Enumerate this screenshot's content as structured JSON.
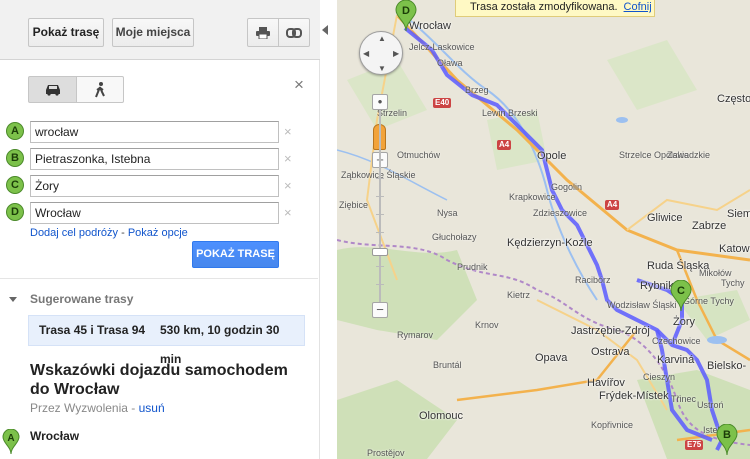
{
  "toolbar": {
    "show_route_label": "Pokaż trasę",
    "my_places_label": "Moje miejsca",
    "print_icon": "printer-icon",
    "link_icon": "link-icon"
  },
  "mode": {
    "car_icon": "car-icon",
    "walk_icon": "walking-icon"
  },
  "waypoints": [
    {
      "letter": "A",
      "value": "wrocław"
    },
    {
      "letter": "B",
      "value": "Pietraszonka, Istebna"
    },
    {
      "letter": "C",
      "value": "Żory"
    },
    {
      "letter": "D",
      "value": "Wrocław"
    }
  ],
  "links": {
    "add_destination": "Dodaj cel podróży",
    "separator": " - ",
    "show_options": "Pokaż opcje"
  },
  "go_button_label": "POKAŻ TRASĘ",
  "suggested": {
    "title": "Sugerowane trasy",
    "route_name": "Trasa 45 i Trasa 94",
    "route_info": "530 km, 10 godzin 30 min"
  },
  "directions": {
    "heading": "Wskazówki dojazdu samochodem do Wrocław",
    "via_prefix": "Przez Wyzwolenia",
    "via_separator": " - ",
    "remove_link": "usuń",
    "start_label": "Wrocław",
    "start_letter": "A"
  },
  "map": {
    "notice_text": "Trasa została zmodyfikowana.",
    "undo_link": "Cofnij",
    "route_color": "#5a5aff",
    "marker_color": "#7cc14a",
    "cities": [
      {
        "name": "Wrocław",
        "cls": "city"
      },
      {
        "name": "Opole",
        "cls": "city"
      },
      {
        "name": "Gliwice",
        "cls": "city"
      },
      {
        "name": "Zabrze",
        "cls": "city"
      },
      {
        "name": "Katowic",
        "cls": "city"
      },
      {
        "name": "Ruda Śląska",
        "cls": "city"
      },
      {
        "name": "Rybnik",
        "cls": "city"
      },
      {
        "name": "Żory",
        "cls": "city"
      },
      {
        "name": "Ostrava",
        "cls": "city"
      },
      {
        "name": "Opava",
        "cls": "city"
      },
      {
        "name": "Jastrzębie-Zdrój",
        "cls": "city"
      },
      {
        "name": "Karviná",
        "cls": "city"
      },
      {
        "name": "Havířov",
        "cls": "city"
      },
      {
        "name": "Frýdek-Místek",
        "cls": "city"
      },
      {
        "name": "Bielsko-",
        "cls": "city"
      },
      {
        "name": "Olomouc",
        "cls": "city"
      },
      {
        "name": "Kędzierzyn-Koźle",
        "cls": "city"
      },
      {
        "name": "Często",
        "cls": "city"
      },
      {
        "name": "Siemi",
        "cls": "city"
      },
      {
        "name": "Brzeg",
        "cls": "town"
      },
      {
        "name": "Oława",
        "cls": "town"
      },
      {
        "name": "Jelcz-Laskowice",
        "cls": "town"
      },
      {
        "name": "Lewin Brzeski",
        "cls": "town"
      },
      {
        "name": "Strzelin",
        "cls": "town"
      },
      {
        "name": "Nysa",
        "cls": "town"
      },
      {
        "name": "Krapkowice",
        "cls": "town"
      },
      {
        "name": "Gogolin",
        "cls": "town"
      },
      {
        "name": "Zdzieszowice",
        "cls": "town"
      },
      {
        "name": "Głuchołazy",
        "cls": "town"
      },
      {
        "name": "Racibórz",
        "cls": "town"
      },
      {
        "name": "Wodzisław Śląski",
        "cls": "town"
      },
      {
        "name": "Krnov",
        "cls": "town"
      },
      {
        "name": "Třinec",
        "cls": "town"
      },
      {
        "name": "Ustroń",
        "cls": "town"
      },
      {
        "name": "Istebna",
        "cls": "town"
      },
      {
        "name": "Kopřivnice",
        "cls": "town"
      },
      {
        "name": "Ząbkowice Śląskie",
        "cls": "town"
      },
      {
        "name": "Prostějov",
        "cls": "town"
      },
      {
        "name": "Ziębice",
        "cls": "town"
      },
      {
        "name": "Otmuchów",
        "cls": "town"
      },
      {
        "name": "Prudnik",
        "cls": "town"
      },
      {
        "name": "Kietrz",
        "cls": "town"
      },
      {
        "name": "Bruntál",
        "cls": "town"
      },
      {
        "name": "Rymarov",
        "cls": "town"
      },
      {
        "name": "Tychy",
        "cls": "town"
      },
      {
        "name": "Mikołów",
        "cls": "town"
      },
      {
        "name": "Czechowice",
        "cls": "town"
      },
      {
        "name": "Cieszyn",
        "cls": "town"
      },
      {
        "name": "Górne Tychy",
        "cls": "town"
      },
      {
        "name": "Strzelce Opolskie",
        "cls": "town"
      },
      {
        "name": "Zawadzkie",
        "cls": "town"
      }
    ],
    "road_shields": [
      "E40",
      "A4",
      "A4",
      "E75"
    ],
    "markers": [
      "D",
      "C",
      "B"
    ]
  }
}
